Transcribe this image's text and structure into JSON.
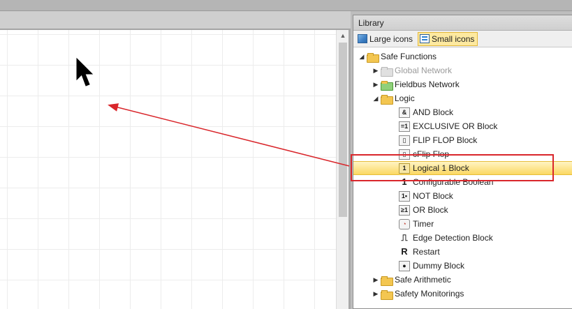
{
  "library": {
    "title": "Library",
    "toolbar": {
      "large_icons": "Large icons",
      "small_icons": "Small icons"
    },
    "tree": [
      {
        "label": "Safe Functions",
        "level": 0,
        "expander": "expanded",
        "icon": "folder-icon"
      },
      {
        "label": "Global Network",
        "level": 1,
        "expander": "collapsed",
        "icon": "folder-icon",
        "faded": true
      },
      {
        "label": "Fieldbus Network",
        "level": 1,
        "expander": "collapsed",
        "icon": "fieldbus-folder-icon"
      },
      {
        "label": "Logic",
        "level": 1,
        "expander": "expanded",
        "icon": "folder-icon"
      },
      {
        "label": "AND Block",
        "level": 2,
        "icon_text": "&"
      },
      {
        "label": "EXCLUSIVE OR Block",
        "level": 2,
        "icon_text": "=1"
      },
      {
        "label": "FLIP FLOP Block",
        "level": 2,
        "icon_text": "▯"
      },
      {
        "label": "cFlip Flop",
        "level": 2,
        "icon_text": "▯"
      },
      {
        "label": "Logical 1 Block",
        "level": 2,
        "icon_text": "1",
        "selected": true
      },
      {
        "label": "Configurable Boolean",
        "level": 2,
        "icon_text": "1"
      },
      {
        "label": "NOT Block",
        "level": 2,
        "icon_text": "1•"
      },
      {
        "label": "OR Block",
        "level": 2,
        "icon_text": "≥1"
      },
      {
        "label": "Timer",
        "level": 2,
        "icon_text": "◔"
      },
      {
        "label": "Edge Detection Block",
        "level": 2,
        "icon_text": "⎍"
      },
      {
        "label": "Restart",
        "level": 2,
        "icon_text": "R"
      },
      {
        "label": "Dummy Block",
        "level": 2,
        "icon_text": "●"
      },
      {
        "label": "Safe Arithmetic",
        "level": 1,
        "expander": "collapsed",
        "icon": "folder-icon"
      },
      {
        "label": "Safety Monitorings",
        "level": 1,
        "expander": "collapsed",
        "icon": "folder-icon"
      }
    ]
  },
  "colors": {
    "selection_fill": "#fbd862",
    "annotation_red": "#d9262b"
  },
  "canvas": {
    "scroll_up_glyph": "▲"
  }
}
